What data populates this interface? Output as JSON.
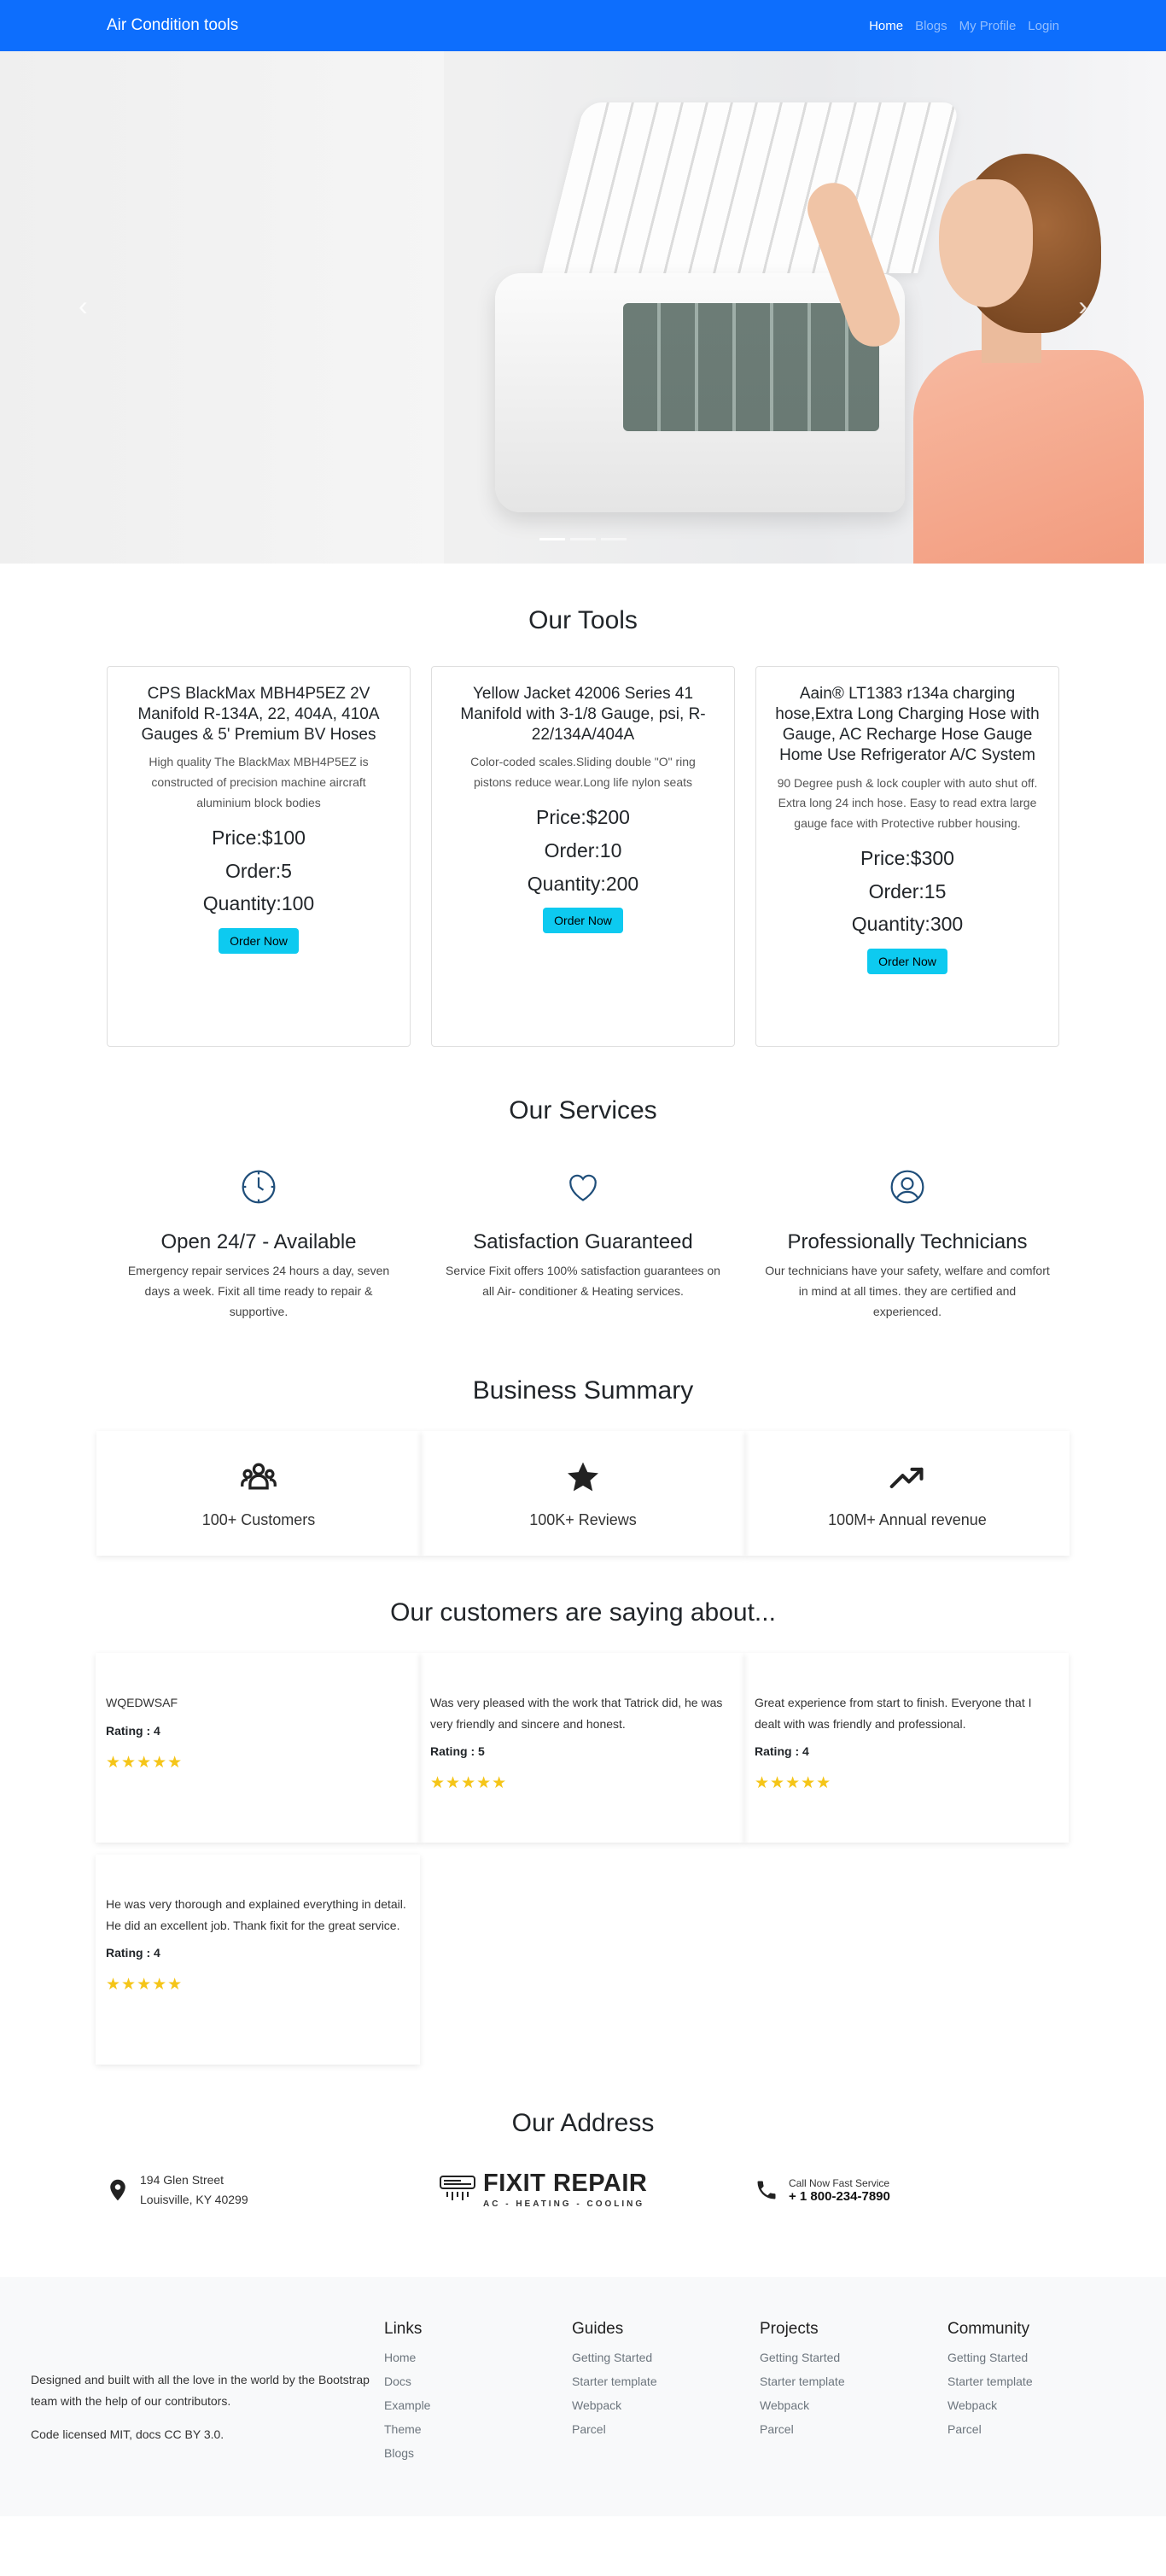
{
  "navbar": {
    "brand": "Air Condition tools",
    "links": [
      "Home",
      "Blogs",
      "My Profile",
      "Login"
    ]
  },
  "tools": {
    "title": "Our Tools",
    "items": [
      {
        "name": "CPS BlackMax MBH4P5EZ 2V Manifold R-134A, 22, 404A, 410A Gauges & 5' Premium BV Hoses",
        "description": "High quality The BlackMax MBH4P5EZ is constructed of precision machine aircraft aluminium block bodies",
        "price": "Price:$100",
        "order": "Order:5",
        "quantity": "Quantity:100",
        "button": "Order Now"
      },
      {
        "name": "Yellow Jacket 42006 Series 41 Manifold with 3-1/8 Gauge, psi, R-22/134A/404A",
        "description": "Color-coded scales.Sliding double \"O\" ring pistons reduce wear.Long life nylon seats",
        "price": "Price:$200",
        "order": "Order:10",
        "quantity": "Quantity:200",
        "button": "Order Now"
      },
      {
        "name": "Aain® LT1383 r134a charging hose,Extra Long Charging Hose with Gauge, AC Recharge Hose Gauge Home Use Refrigerator A/C System",
        "description": "90 Degree push & lock coupler with auto shut off. Extra long 24 inch hose. Easy to read extra large gauge face with Protective rubber housing.",
        "price": "Price:$300",
        "order": "Order:15",
        "quantity": "Quantity:300",
        "button": "Order Now"
      }
    ]
  },
  "services": {
    "title": "Our Services",
    "items": [
      {
        "icon": "clock-icon",
        "title": "Open 24/7 - Available",
        "text": "Emergency repair services 24 hours a day, seven days a week. Fixit all time ready to repair & supportive."
      },
      {
        "icon": "heart-icon",
        "title": "Satisfaction Guaranteed",
        "text": "Service Fixit offers 100% satisfaction guarantees on all Air- conditioner & Heating services."
      },
      {
        "icon": "user-circle-icon",
        "title": "Professionally Technicians",
        "text": "Our technicians have your safety, welfare and comfort in mind at all times. they are certified and experienced."
      }
    ]
  },
  "summary": {
    "title": "Business Summary",
    "items": [
      {
        "icon": "people-icon",
        "label": "100+ Customers"
      },
      {
        "icon": "star-icon",
        "label": "100K+ Reviews"
      },
      {
        "icon": "trending-up-icon",
        "label": "100M+ Annual revenue"
      }
    ]
  },
  "reviews": {
    "title": "Our customers are saying about...",
    "items": [
      {
        "text": "WQEDWSAF",
        "rating": "Rating : 4",
        "stars": "★★★★★"
      },
      {
        "text": "Was very pleased with the work that Tatrick did, he was very friendly and sincere and honest.",
        "rating": "Rating : 5",
        "stars": "★★★★★"
      },
      {
        "text": "Great experience from start to finish. Everyone that I dealt with was friendly and professional.",
        "rating": "Rating : 4",
        "stars": "★★★★★"
      },
      {
        "text": "He was very thorough and explained everything in detail. He did an excellent job. Thank fixit for the great service.",
        "rating": "Rating : 4",
        "stars": "★★★★★"
      }
    ]
  },
  "address": {
    "title": "Our Address",
    "street": "194 Glen Street",
    "city": "Louisville, KY 40299",
    "logo_title": "FIXIT REPAIR",
    "logo_sub": "AC - HEATING - COOLING",
    "call_label": "Call Now Fast Service",
    "phone": "+ 1 800-234-7890"
  },
  "footer": {
    "about": "Designed and built with all the love in the world by the Bootstrap team with the help of our contributors.",
    "license": "Code licensed MIT, docs CC BY 3.0.",
    "columns": [
      {
        "title": "Links",
        "items": [
          "Home",
          "Docs",
          "Example",
          "Theme",
          "Blogs"
        ]
      },
      {
        "title": "Guides",
        "items": [
          "Getting Started",
          "Starter template",
          "Webpack",
          "Parcel"
        ]
      },
      {
        "title": "Projects",
        "items": [
          "Getting Started",
          "Starter template",
          "Webpack",
          "Parcel"
        ]
      },
      {
        "title": "Community",
        "items": [
          "Getting Started",
          "Starter template",
          "Webpack",
          "Parcel"
        ]
      }
    ]
  },
  "colors": {
    "primary": "#0d6efd",
    "info": "#0dcaf0",
    "star": "#f5c518",
    "icon_blue": "#1f4e7a"
  }
}
